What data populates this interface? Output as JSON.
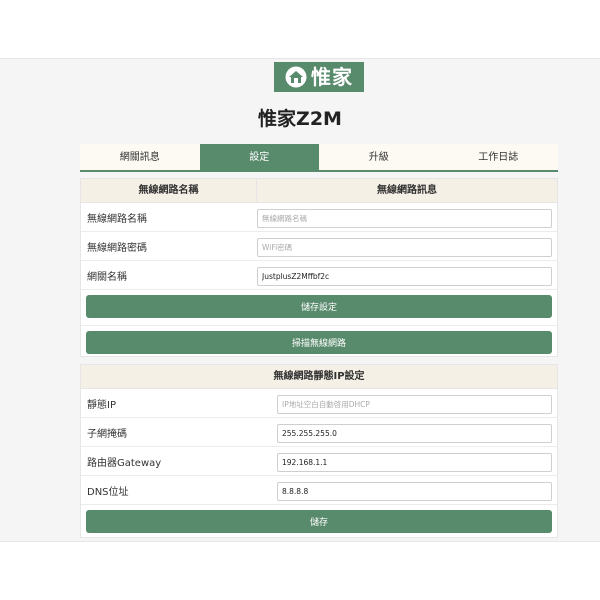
{
  "brand": {
    "logo_text": "惟家",
    "accent_color": "#588a6c"
  },
  "page_title": "惟家Z2M",
  "tabs": [
    {
      "label": "網關訊息",
      "active": false
    },
    {
      "label": "設定",
      "active": true
    },
    {
      "label": "升級",
      "active": false
    },
    {
      "label": "工作日誌",
      "active": false
    }
  ],
  "wifi": {
    "col1_header": "無線網路名稱",
    "col2_header": "無線網路訊息",
    "rows": [
      {
        "label": "無線網路名稱",
        "value": "",
        "placeholder": "無線網路名稱"
      },
      {
        "label": "無線網路密碼",
        "value": "",
        "placeholder": "WiFi密碼"
      },
      {
        "label": "網關名稱",
        "value": "JustplusZ2Mffbf2c",
        "placeholder": ""
      }
    ],
    "save_button": "儲存設定",
    "scan_button": "掃描無線網路"
  },
  "static_ip": {
    "header": "無線網路靜態IP設定",
    "rows": [
      {
        "label": "靜態IP",
        "value": "",
        "placeholder": "IP地址空白自動啓用DHCP"
      },
      {
        "label": "子網掩碼",
        "value": "255.255.255.0",
        "placeholder": ""
      },
      {
        "label": "路由器Gateway",
        "value": "192.168.1.1",
        "placeholder": ""
      },
      {
        "label": "DNS位址",
        "value": "8.8.8.8",
        "placeholder": ""
      }
    ],
    "save_button": "儲存"
  }
}
